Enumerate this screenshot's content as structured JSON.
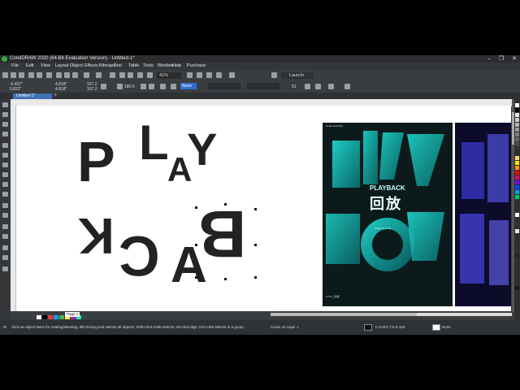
{
  "window": {
    "title": "CorelDRAW 2020 (64-Bit Evaluation Version) - Untitled-1*",
    "controls": [
      "–",
      "❐",
      "✕"
    ]
  },
  "menu": [
    "File",
    "Edit",
    "View",
    "Layout",
    "Object",
    "Effects",
    "Bitmaps",
    "Text",
    "Table",
    "Tools",
    "Window",
    "Help",
    "Purchase"
  ],
  "toolbar": {
    "zoom": "41%",
    "launch": "Launch"
  },
  "property_bar": {
    "x": "-5.497\"",
    "y": "5.822\"",
    "w": "4.818\"",
    "h": "4.818\"",
    "sx": "157.2",
    "sy": "157.2",
    "rotation": "180.0",
    "line_style": "None",
    "outline_width": "51"
  },
  "document_tab": {
    "label": "Untitled-1*"
  },
  "canvas": {
    "letters_top": [
      "P",
      "L",
      "A",
      "Y"
    ],
    "letters_bottom": [
      "B",
      "A",
      "C",
      "K"
    ]
  },
  "poster": {
    "title": "PLAYBACK",
    "chinese": "回放",
    "header_small": "Under Dark Sky",
    "dates": "2015.6.6-11.15",
    "footer": "NYM 上海展"
  },
  "page_tab": "Page 1",
  "status": {
    "hint": "Click an object twice for rotating/skewing; dbl-clicking tool selects all objects; Shift+click multi-selects; Alt+click digs; Ctrl+click selects in a group",
    "layer": "Curve on Layer 1",
    "fill_color": "C:0 M:0 Y:0 K:100",
    "outline": "None"
  },
  "palette_colors": [
    "#ffffff",
    "#000000",
    "#e6e6e6",
    "#cccccc",
    "#b3b3b3",
    "#999999",
    "#808080",
    "#666666",
    "#4d4d4d",
    "#333333",
    "#ffd966",
    "#ffe600",
    "#ff9900",
    "#ff0000",
    "#e6007e",
    "#7a00ff",
    "#0044ff",
    "#00a0e9",
    "#00cc66",
    "#ffffff",
    "#e4e4e4",
    "#222222",
    "#1a1a1a"
  ],
  "document_palette": [
    "#ffffff",
    "#000000",
    "#e53935",
    "#2196f3",
    "#4caf50",
    "#ffeb3b",
    "#9c27b0",
    "#1de9b6",
    "#37474f"
  ]
}
